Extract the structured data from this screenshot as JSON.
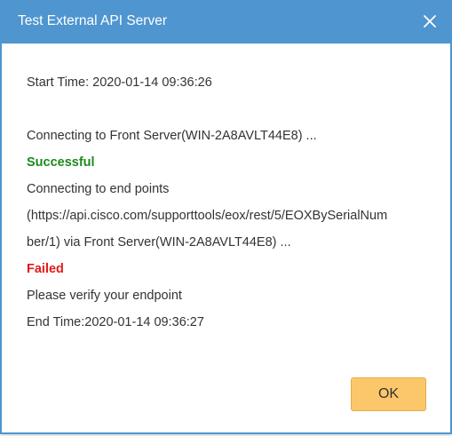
{
  "dialog": {
    "title": "Test External API Server",
    "close_icon": "close-icon",
    "ok_label": "OK"
  },
  "log": {
    "start_time": "Start Time: 2020-01-14 09:36:26",
    "connect_front": "Connecting to Front Server(WIN-2A8AVLT44E8) ...",
    "status_success": "Successful",
    "connect_endpoints": "Connecting to end points",
    "endpoint_url_part1": "(https://api.cisco.com/supporttools/eox/rest/5/EOXBySerialNum",
    "endpoint_url_part2": "ber/1) via Front Server(WIN-2A8AVLT44E8) ...",
    "status_failed": "Failed",
    "verify_message": "Please verify your endpoint",
    "end_time": "End Time:2020-01-14 09:36:27"
  },
  "colors": {
    "titlebar": "#4f95cf",
    "success": "#1c8a1c",
    "failed": "#e31b1b",
    "ok_button": "#fbc76a"
  }
}
